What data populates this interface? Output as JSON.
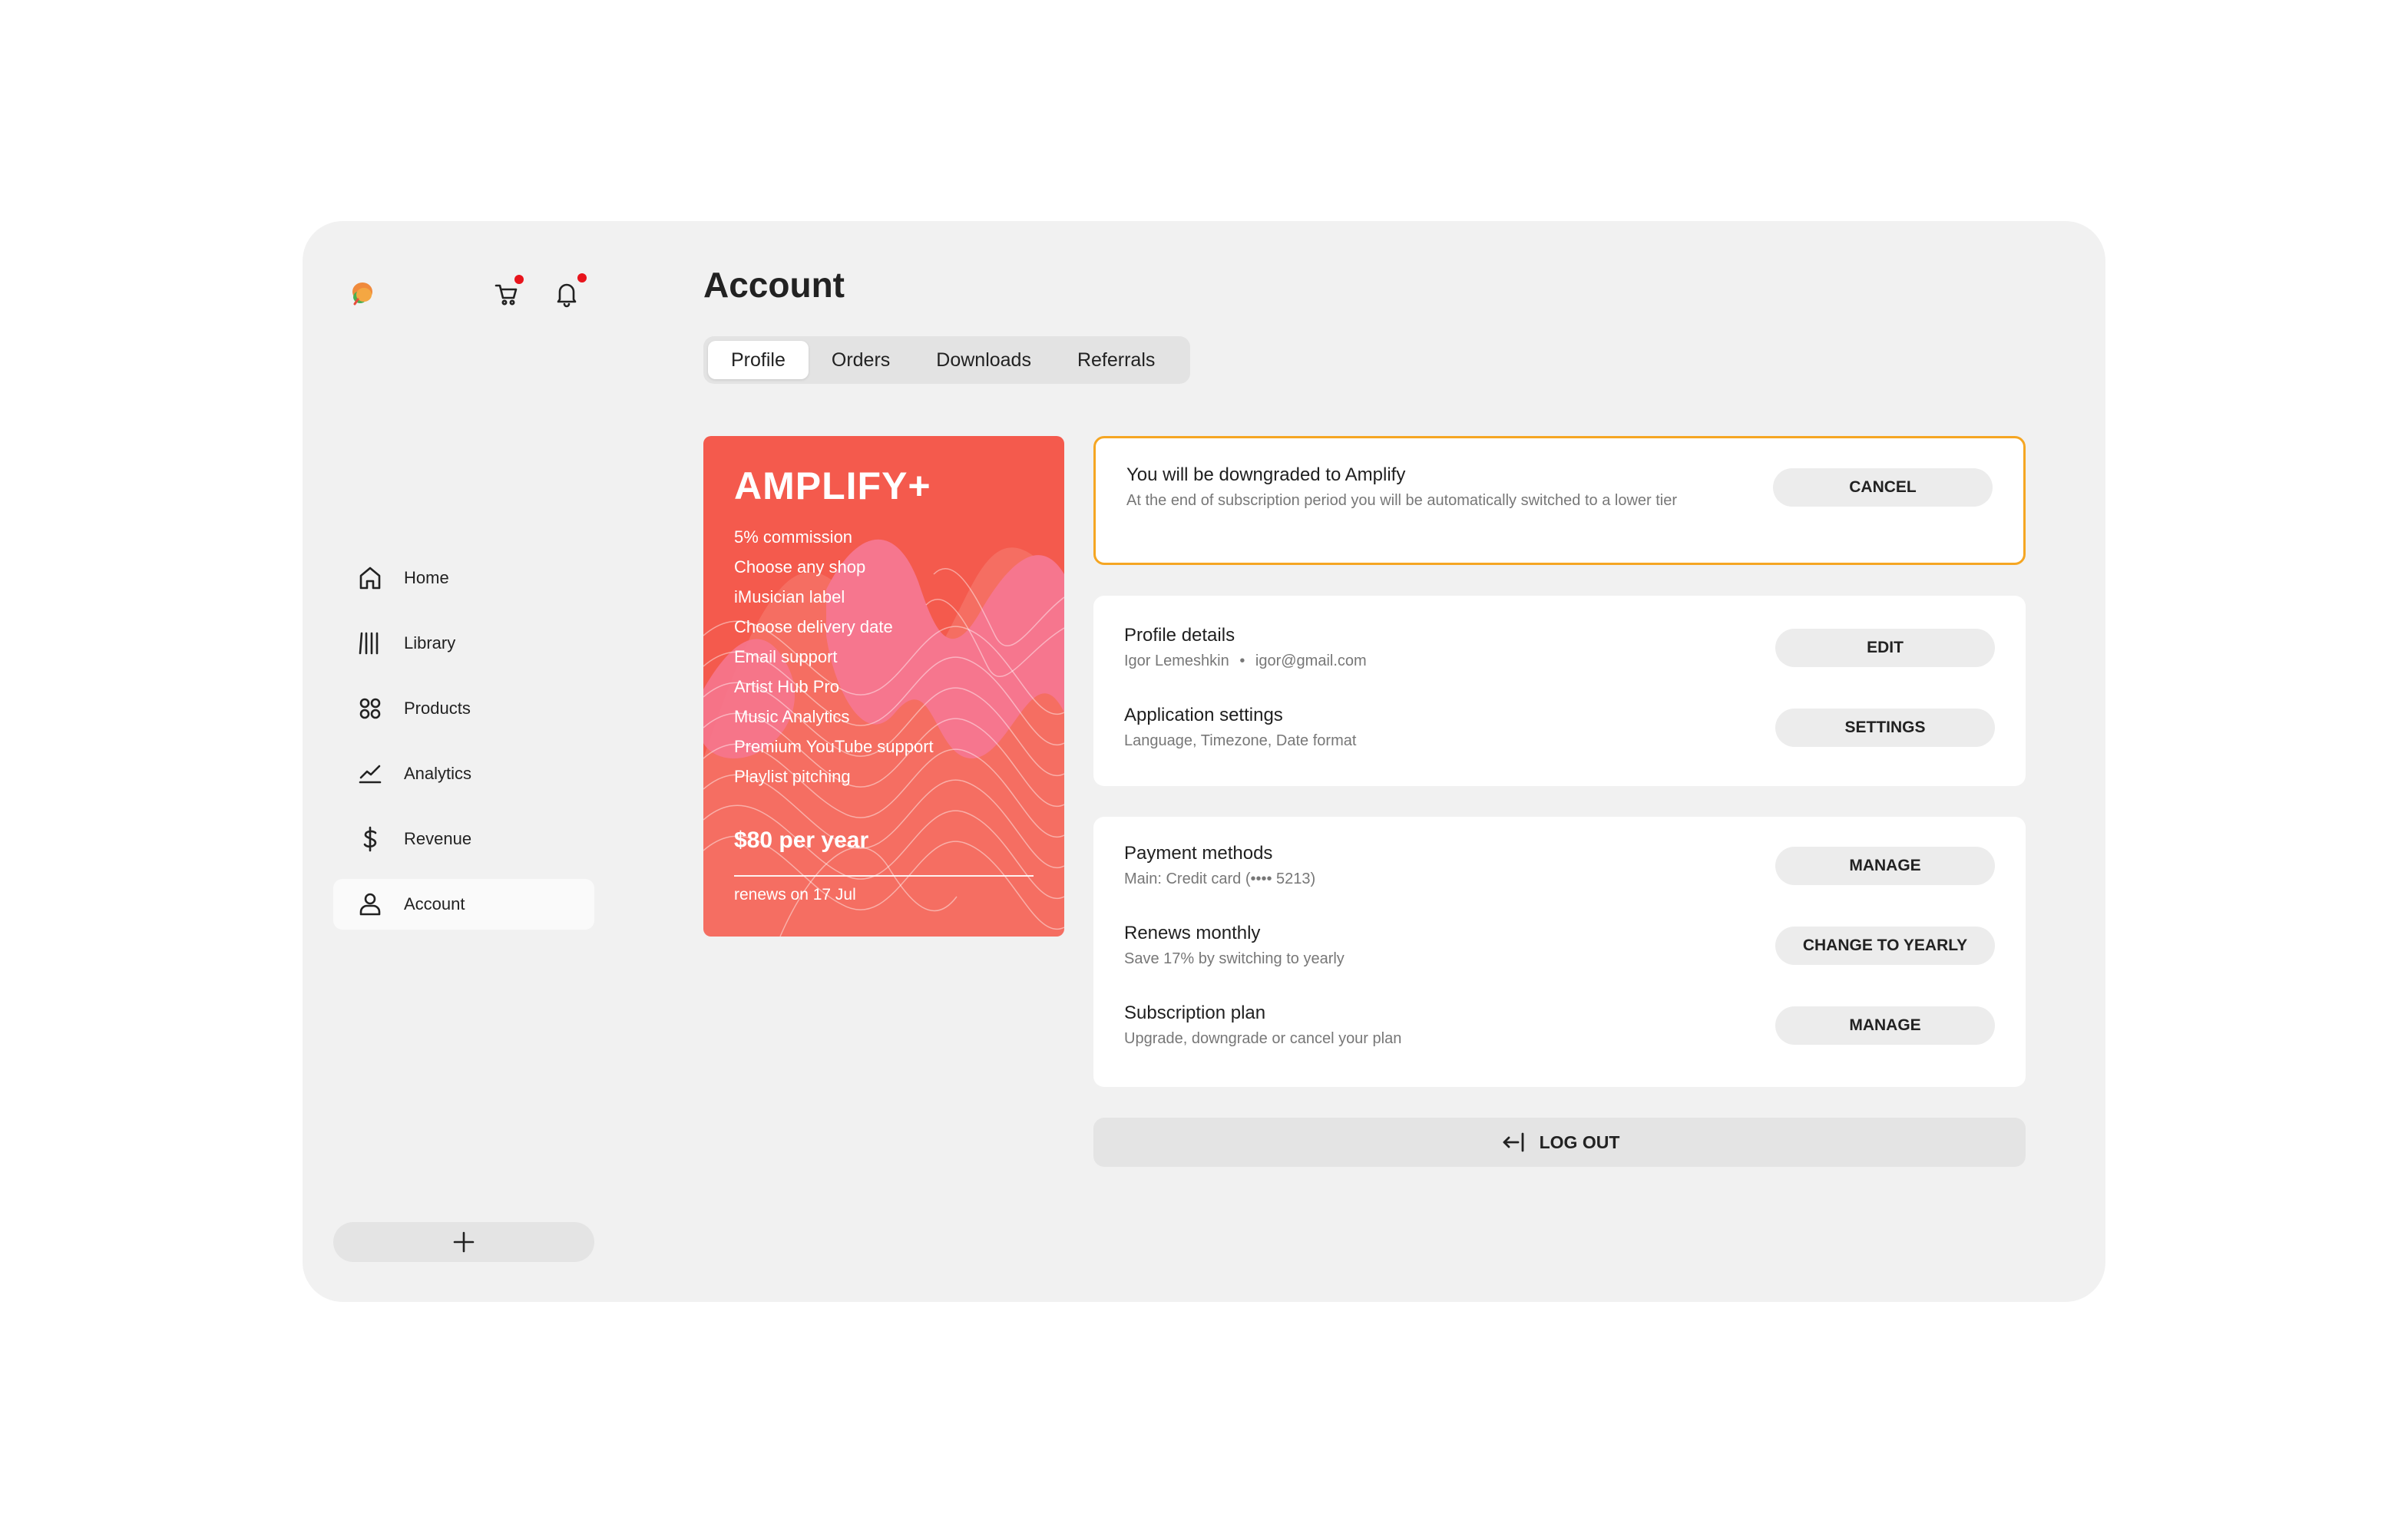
{
  "sidebar": {
    "logo_icon": "mango-logo-icon",
    "cart_icon": "cart-icon",
    "bell_icon": "bell-icon",
    "notification_dot_color": "#e8141c",
    "items": [
      {
        "label": "Home",
        "icon": "home-icon"
      },
      {
        "label": "Library",
        "icon": "library-icon"
      },
      {
        "label": "Products",
        "icon": "products-icon"
      },
      {
        "label": "Analytics",
        "icon": "analytics-icon"
      },
      {
        "label": "Revenue",
        "icon": "dollar-icon"
      },
      {
        "label": "Account",
        "icon": "user-icon",
        "active": true
      }
    ],
    "add_icon": "plus-icon"
  },
  "page": {
    "title": "Account",
    "tabs": [
      "Profile",
      "Orders",
      "Downloads",
      "Referrals"
    ],
    "active_tab": "Profile"
  },
  "plan": {
    "name": "AMPLIFY+",
    "features": [
      "5% commission",
      "Choose any shop",
      "iMusician label",
      "Choose delivery date",
      "Email support",
      "Artist Hub Pro",
      "Music Analytics",
      "Premium YouTube support",
      "Playlist pitching"
    ],
    "price": "$80 per year",
    "renews": "renews on 17 Jul",
    "color": "#f45a4d"
  },
  "notice": {
    "title": "You will be downgraded to Amplify",
    "subtitle": "At the end of subscription period you will be automatically switched to a lower tier",
    "button": "CANCEL",
    "border_color": "#f5a623"
  },
  "profile_card": {
    "rows": [
      {
        "title": "Profile details",
        "subtitle_name": "Igor Lemeshkin",
        "subtitle_sep": "•",
        "subtitle_email": "igor@gmail.com",
        "button": "EDIT"
      },
      {
        "title": "Application settings",
        "subtitle": "Language, Timezone, Date format",
        "button": "SETTINGS"
      }
    ]
  },
  "billing_card": {
    "rows": [
      {
        "title": "Payment methods",
        "subtitle": "Main: Credit card (•••• 5213)",
        "button": "MANAGE"
      },
      {
        "title": "Renews monthly",
        "subtitle": "Save 17% by switching to yearly",
        "button": "CHANGE TO YEARLY"
      },
      {
        "title": "Subscription plan",
        "subtitle": "Upgrade, downgrade or cancel your plan",
        "button": "MANAGE"
      }
    ]
  },
  "logout": {
    "label": "LOG OUT",
    "icon": "logout-icon"
  }
}
